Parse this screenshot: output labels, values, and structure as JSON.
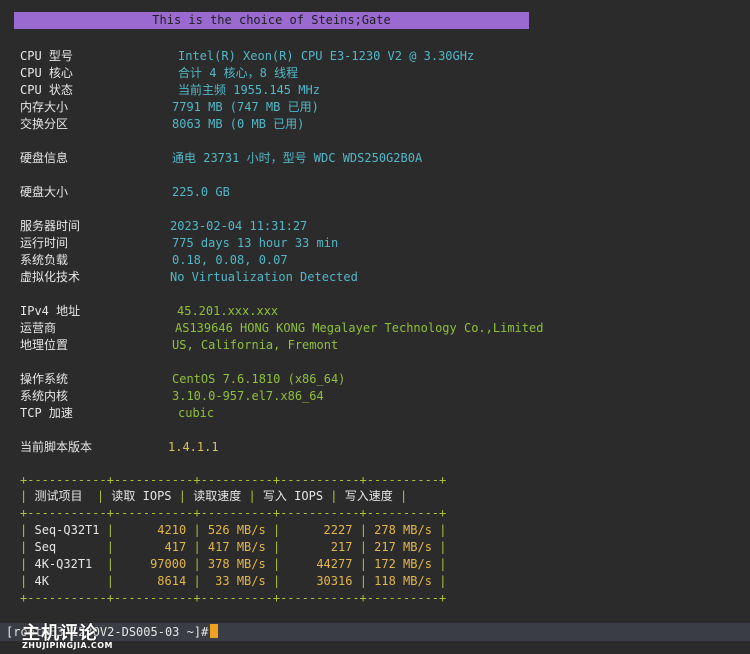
{
  "banner": "This is the choice of Steins;Gate",
  "sysinfo": [
    {
      "label": "CPU 型号",
      "value": "Intel(R) Xeon(R) CPU E3-1230 V2 @ 3.30GHz",
      "color": "cyan"
    },
    {
      "label": "CPU 核心",
      "value": "合计 4 核心，8 线程",
      "color": "cyan"
    },
    {
      "label": "CPU 状态",
      "value": "当前主频 1955.145 MHz",
      "color": "cyan"
    },
    {
      "label": "内存大小",
      "value": "7791 MB (747 MB 已用)",
      "color": "cyan"
    },
    {
      "label": "交换分区",
      "value": "8063 MB (0 MB 已用)",
      "color": "cyan"
    },
    {
      "label": "硬盘信息",
      "value": "通电 23731 小时，型号 WDC WDS250G2B0A",
      "color": "cyan"
    },
    {
      "label": "硬盘大小",
      "value": "225.0 GB",
      "color": "cyan"
    },
    {
      "label": "服务器时间",
      "value": "2023-02-04 11:31:27",
      "color": "cyan"
    },
    {
      "label": "运行时间",
      "value": "775 days 13 hour 33 min",
      "color": "cyan"
    },
    {
      "label": "系统负载",
      "value": "0.18, 0.08, 0.07",
      "color": "cyan"
    },
    {
      "label": "虚拟化技术",
      "value": "No Virtualization Detected",
      "color": "cyan"
    },
    {
      "label": "IPv4 地址",
      "value": "45.201.xxx.xxx",
      "color": "green"
    },
    {
      "label": "运营商",
      "value": "AS139646 HONG KONG Megalayer Technology Co.,Limited",
      "color": "green"
    },
    {
      "label": "地理位置",
      "value": "US, California, Fremont",
      "color": "green"
    },
    {
      "label": "操作系统",
      "value": "CentOS 7.6.1810   (x86_64)",
      "color": "green"
    },
    {
      "label": "系统内核",
      "value": "3.10.0-957.el7.x86_64",
      "color": "green"
    },
    {
      "label": "TCP 加速",
      "value": "cubic",
      "color": "green"
    },
    {
      "label": "当前脚本版本",
      "value": "1.4.1.1",
      "color": "yellow"
    }
  ],
  "iops_table": {
    "border": "+-----------+-----------+----------+-----------+----------+",
    "headers": [
      "测试项目",
      "读取 IOPS",
      "读取速度",
      "写入 IOPS",
      "写入速度"
    ],
    "rows": [
      {
        "test": "Seq-Q32T1",
        "read_iops": "4210",
        "read_speed": "526 MB/s",
        "write_iops": "2227",
        "write_speed": "278 MB/s"
      },
      {
        "test": "Seq",
        "read_iops": "417",
        "read_speed": "417 MB/s",
        "write_iops": "217",
        "write_speed": "217 MB/s"
      },
      {
        "test": "4K-Q32T1",
        "read_iops": "97000",
        "read_speed": "378 MB/s",
        "write_iops": "44277",
        "write_speed": "172 MB/s"
      },
      {
        "test": "4K",
        "read_iops": "8614",
        "read_speed": "33 MB/s",
        "write_iops": "30316",
        "write_speed": "118 MB/s"
      }
    ]
  },
  "prompt": {
    "text": "[root@E3-1230V2-DS005-03 ~]#"
  },
  "watermark": {
    "main": "主机评论",
    "sub": "ZHUJIPINGJIA.COM"
  },
  "colors": {
    "background": "#2b2b2b",
    "banner": "#9b6ad0",
    "cyan": "#52b7c7",
    "green": "#8fbf3e",
    "yellow": "#d7c35a",
    "table_border": "#a6c23a",
    "numbers": "#e3b64b",
    "cursor": "#f0a020"
  }
}
